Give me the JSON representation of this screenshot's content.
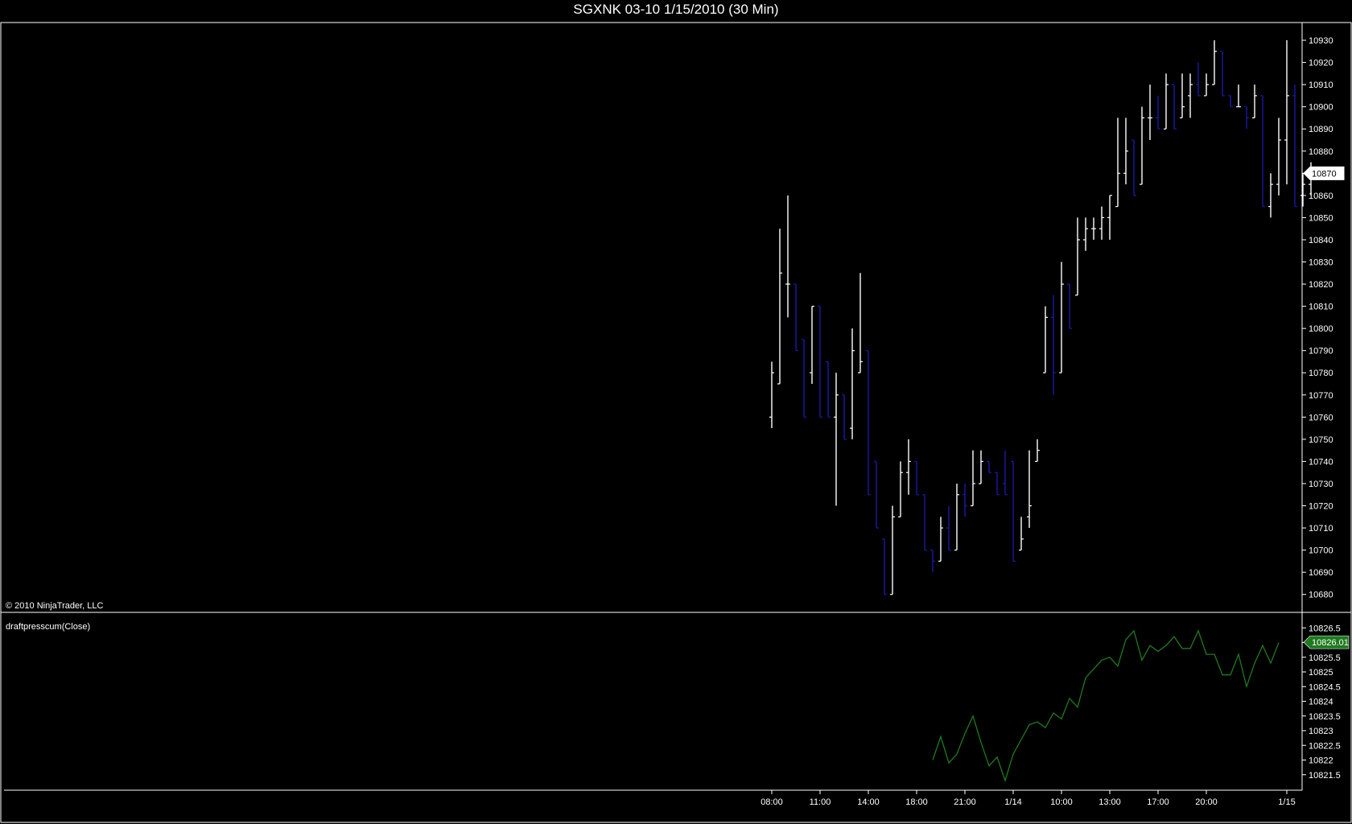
{
  "window": {
    "title": "SGXNK 03-10  1/15/2010 (30 Min)"
  },
  "copyright": "© 2010 NinjaTrader, LLC",
  "indicator_label": "draftpresscum(Close)",
  "colors": {
    "background": "#000000",
    "axis": "#ffffff",
    "up_bar": "#ffffff",
    "down_bar": "#1a1aa8",
    "indicator_line": "#1f7a1f",
    "indicator_badge": "#1f7a1f"
  },
  "chart_data": [
    {
      "type": "ohlc",
      "title": "SGXNK 03-10  1/15/2010 (30 Min)",
      "price_axis": {
        "ylim": [
          10673,
          10938
        ],
        "ticks": [
          10930,
          10920,
          10910,
          10900,
          10890,
          10880,
          10870,
          10860,
          10850,
          10840,
          10830,
          10820,
          10810,
          10800,
          10790,
          10780,
          10770,
          10760,
          10750,
          10740,
          10730,
          10720,
          10710,
          10700,
          10690,
          10680
        ],
        "last_price_label": "10870",
        "last_price": 10870,
        "position": "right"
      },
      "time_axis": {
        "tick_labels": [
          "08:00",
          "11:00",
          "14:00",
          "18:00",
          "21:00",
          "1/14",
          "10:00",
          "13:00",
          "17:00",
          "20:00",
          "1/15"
        ]
      },
      "bars": [
        {
          "o": 10760,
          "h": 10785,
          "l": 10755,
          "c": 10780
        },
        {
          "o": 10775,
          "h": 10845,
          "l": 10775,
          "c": 10825
        },
        {
          "o": 10820,
          "h": 10860,
          "l": 10805,
          "c": 10820
        },
        {
          "o": 10820,
          "h": 10820,
          "l": 10790,
          "c": 10790
        },
        {
          "o": 10795,
          "h": 10795,
          "l": 10760,
          "c": 10760
        },
        {
          "o": 10780,
          "h": 10810,
          "l": 10775,
          "c": 10810
        },
        {
          "o": 10810,
          "h": 10810,
          "l": 10760,
          "c": 10760
        },
        {
          "o": 10785,
          "h": 10785,
          "l": 10760,
          "c": 10760
        },
        {
          "o": 10760,
          "h": 10780,
          "l": 10720,
          "c": 10770
        },
        {
          "o": 10770,
          "h": 10770,
          "l": 10750,
          "c": 10750
        },
        {
          "o": 10755,
          "h": 10800,
          "l": 10750,
          "c": 10790
        },
        {
          "o": 10780,
          "h": 10825,
          "l": 10780,
          "c": 10785
        },
        {
          "o": 10790,
          "h": 10790,
          "l": 10725,
          "c": 10725
        },
        {
          "o": 10740,
          "h": 10740,
          "l": 10710,
          "c": 10710
        },
        {
          "o": 10705,
          "h": 10705,
          "l": 10680,
          "c": 10680
        },
        {
          "o": 10680,
          "h": 10720,
          "l": 10680,
          "c": 10715
        },
        {
          "o": 10715,
          "h": 10740,
          "l": 10715,
          "c": 10735
        },
        {
          "o": 10735,
          "h": 10750,
          "l": 10725,
          "c": 10740
        },
        {
          "o": 10740,
          "h": 10740,
          "l": 10725,
          "c": 10725
        },
        {
          "o": 10725,
          "h": 10725,
          "l": 10700,
          "c": 10700
        },
        {
          "o": 10700,
          "h": 10700,
          "l": 10690,
          "c": 10695
        },
        {
          "o": 10695,
          "h": 10715,
          "l": 10695,
          "c": 10710
        },
        {
          "o": 10710,
          "h": 10720,
          "l": 10700,
          "c": 10700
        },
        {
          "o": 10700,
          "h": 10730,
          "l": 10700,
          "c": 10725
        },
        {
          "o": 10725,
          "h": 10730,
          "l": 10715,
          "c": 10720
        },
        {
          "o": 10720,
          "h": 10745,
          "l": 10720,
          "c": 10730
        },
        {
          "o": 10730,
          "h": 10745,
          "l": 10730,
          "c": 10740
        },
        {
          "o": 10740,
          "h": 10740,
          "l": 10735,
          "c": 10735
        },
        {
          "o": 10735,
          "h": 10735,
          "l": 10725,
          "c": 10725
        },
        {
          "o": 10730,
          "h": 10745,
          "l": 10725,
          "c": 10725
        },
        {
          "o": 10740,
          "h": 10740,
          "l": 10695,
          "c": 10695
        },
        {
          "o": 10700,
          "h": 10715,
          "l": 10700,
          "c": 10705
        },
        {
          "o": 10715,
          "h": 10745,
          "l": 10710,
          "c": 10720
        },
        {
          "o": 10740,
          "h": 10750,
          "l": 10740,
          "c": 10745
        },
        {
          "o": 10780,
          "h": 10810,
          "l": 10780,
          "c": 10805
        },
        {
          "o": 10805,
          "h": 10815,
          "l": 10770,
          "c": 10780
        },
        {
          "o": 10780,
          "h": 10830,
          "l": 10780,
          "c": 10820
        },
        {
          "o": 10820,
          "h": 10820,
          "l": 10800,
          "c": 10800
        },
        {
          "o": 10815,
          "h": 10850,
          "l": 10815,
          "c": 10840
        },
        {
          "o": 10840,
          "h": 10850,
          "l": 10835,
          "c": 10845
        },
        {
          "o": 10845,
          "h": 10850,
          "l": 10840,
          "c": 10845
        },
        {
          "o": 10845,
          "h": 10855,
          "l": 10840,
          "c": 10850
        },
        {
          "o": 10850,
          "h": 10860,
          "l": 10840,
          "c": 10860
        },
        {
          "o": 10855,
          "h": 10895,
          "l": 10855,
          "c": 10870
        },
        {
          "o": 10870,
          "h": 10895,
          "l": 10865,
          "c": 10880
        },
        {
          "o": 10885,
          "h": 10885,
          "l": 10860,
          "c": 10860
        },
        {
          "o": 10865,
          "h": 10900,
          "l": 10865,
          "c": 10895
        },
        {
          "o": 10895,
          "h": 10910,
          "l": 10885,
          "c": 10895
        },
        {
          "o": 10895,
          "h": 10905,
          "l": 10890,
          "c": 10890
        },
        {
          "o": 10890,
          "h": 10915,
          "l": 10890,
          "c": 10910
        },
        {
          "o": 10910,
          "h": 10910,
          "l": 10890,
          "c": 10890
        },
        {
          "o": 10895,
          "h": 10915,
          "l": 10895,
          "c": 10900
        },
        {
          "o": 10905,
          "h": 10915,
          "l": 10895,
          "c": 10910
        },
        {
          "o": 10910,
          "h": 10920,
          "l": 10905,
          "c": 10905
        },
        {
          "o": 10905,
          "h": 10915,
          "l": 10905,
          "c": 10910
        },
        {
          "o": 10910,
          "h": 10930,
          "l": 10910,
          "c": 10925
        },
        {
          "o": 10925,
          "h": 10925,
          "l": 10905,
          "c": 10905
        },
        {
          "o": 10905,
          "h": 10905,
          "l": 10900,
          "c": 10900
        },
        {
          "o": 10900,
          "h": 10910,
          "l": 10900,
          "c": 10900
        },
        {
          "o": 10900,
          "h": 10900,
          "l": 10890,
          "c": 10895
        },
        {
          "o": 10895,
          "h": 10910,
          "l": 10895,
          "c": 10905
        },
        {
          "o": 10905,
          "h": 10905,
          "l": 10855,
          "c": 10855
        },
        {
          "o": 10855,
          "h": 10870,
          "l": 10850,
          "c": 10865
        },
        {
          "o": 10865,
          "h": 10895,
          "l": 10860,
          "c": 10885
        },
        {
          "o": 10885,
          "h": 10930,
          "l": 10865,
          "c": 10905
        },
        {
          "o": 10905,
          "h": 10910,
          "l": 10855,
          "c": 10855
        },
        {
          "o": 10860,
          "h": 10870,
          "l": 10855,
          "c": 10865
        },
        {
          "o": 10865,
          "h": 10875,
          "l": 10860,
          "c": 10870
        }
      ]
    },
    {
      "type": "line",
      "name": "draftpresscum(Close)",
      "y_axis": {
        "ylim": [
          10821.0,
          10827.0
        ],
        "ticks": [
          10826.5,
          10826,
          10825.5,
          10825,
          10824.5,
          10824,
          10823.5,
          10823,
          10822.5,
          10822,
          10821.5
        ],
        "tick_labels": [
          "10826.5",
          "10826",
          "10825.5",
          "10825",
          "10824.5",
          "10824",
          "10823.5",
          "10823",
          "10822.5",
          "10822",
          "10821.5"
        ],
        "last_value_label": "10826.01",
        "last_value": 10826.01
      },
      "start_bar_index": 20,
      "values": [
        10822.0,
        10822.8,
        10821.9,
        10822.2,
        10822.9,
        10823.5,
        10822.6,
        10821.8,
        10822.1,
        10821.3,
        10822.2,
        10822.7,
        10823.2,
        10823.3,
        10823.1,
        10823.6,
        10823.4,
        10824.1,
        10823.8,
        10824.8,
        10825.1,
        10825.4,
        10825.5,
        10825.2,
        10826.1,
        10826.4,
        10825.4,
        10825.9,
        10825.7,
        10825.9,
        10826.2,
        10825.8,
        10825.8,
        10826.4,
        10825.6,
        10825.6,
        10824.9,
        10824.9,
        10825.6,
        10824.5,
        10825.3,
        10825.9,
        10825.3,
        10826.0
      ]
    }
  ]
}
